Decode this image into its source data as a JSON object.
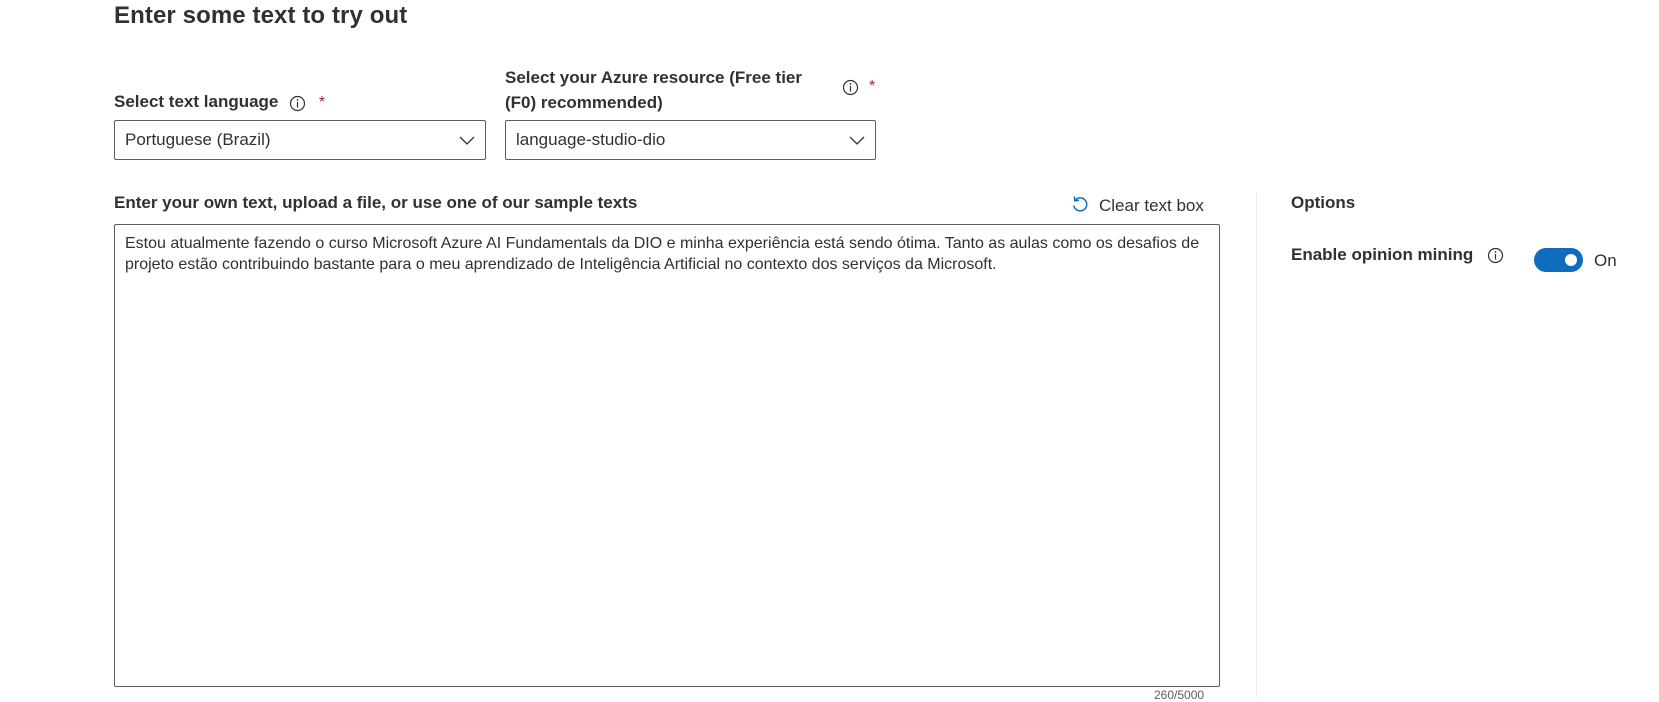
{
  "page": {
    "title": "Enter some text to try out"
  },
  "language_field": {
    "label": "Select text language",
    "required_mark": "*",
    "selected_value": "Portuguese (Brazil)"
  },
  "resource_field": {
    "label_line1": "Select your Azure resource (Free tier",
    "label_line2": "(F0) recommended)",
    "required_mark": "*",
    "selected_value": "language-studio-dio"
  },
  "text_input": {
    "label": "Enter your own text, upload a file, or use one of our sample texts",
    "clear_label": "Clear text box",
    "value": "Estou atualmente fazendo o curso Microsoft Azure AI Fundamentals da DIO e minha experiência está sendo ótima. Tanto as aulas como os desafios de projeto estão contribuindo bastante para o meu aprendizado de Inteligência Artificial no contexto dos serviços da Microsoft.",
    "char_count": "260/5000"
  },
  "options": {
    "title": "Options",
    "opinion_mining_label": "Enable opinion mining",
    "opinion_mining_state": "On",
    "opinion_mining_enabled": true
  },
  "icons": {
    "info": "info-icon",
    "chevron": "chevron-down-icon",
    "clear": "undo-icon"
  },
  "colors": {
    "accent": "#0f6cbd",
    "required": "#a4262c",
    "text": "#323130",
    "border": "#605e5c"
  }
}
